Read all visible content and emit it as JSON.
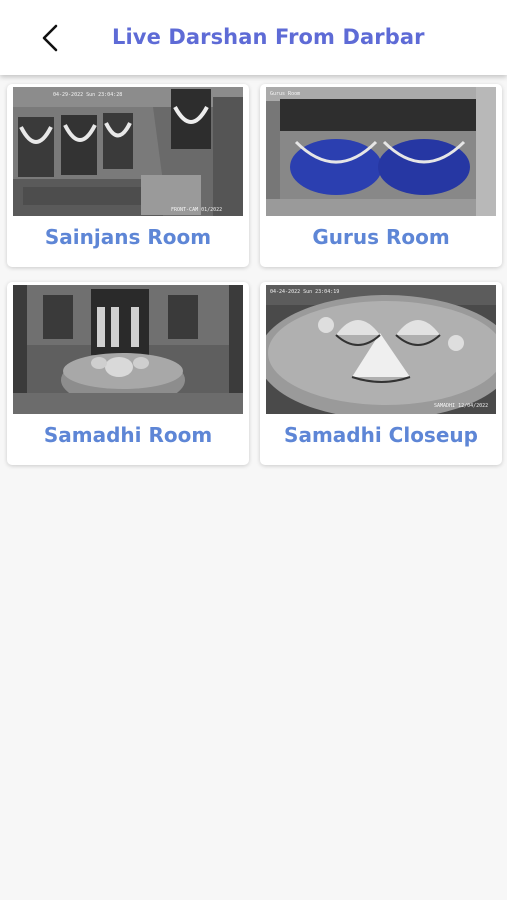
{
  "header": {
    "title": "Live Darshan From Darbar",
    "back_icon": "chevron-left-icon"
  },
  "colors": {
    "title": "#5e6bd6",
    "card_label": "#5e86d6",
    "background": "#f7f7f7"
  },
  "cameras": [
    {
      "label": "Sainjans Room",
      "timestamp_top": "04-29-2022 Sun 23:04:28",
      "timestamp_bottom": "FRONT-CAM 01/2022"
    },
    {
      "label": "Gurus Room",
      "timestamp_top": "Gurus Room",
      "timestamp_bottom": ""
    },
    {
      "label": "Samadhi Room",
      "timestamp_top": "",
      "timestamp_bottom": ""
    },
    {
      "label": "Samadhi Closeup",
      "timestamp_top": "04-24-2022 Sun 23:04:19",
      "timestamp_bottom": "SAMADHI 12/04/2022"
    }
  ]
}
